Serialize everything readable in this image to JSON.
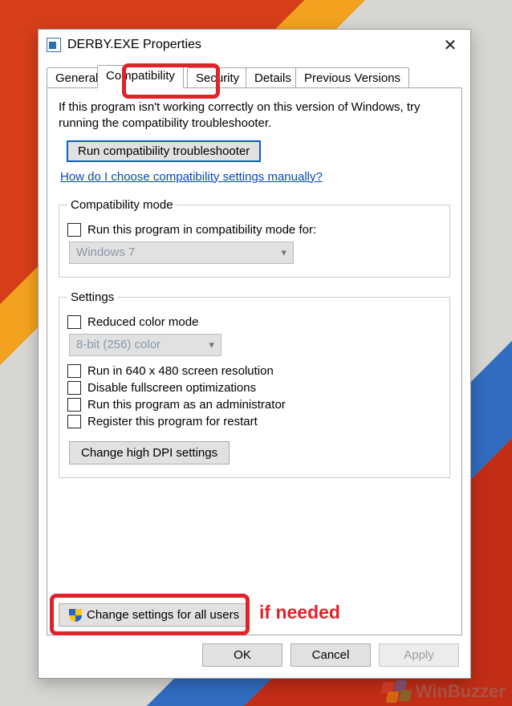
{
  "window": {
    "title": "DERBY.EXE Properties",
    "tabs": {
      "general": "General",
      "compatibility": "Compatibility",
      "security": "Security",
      "details": "Details",
      "previous": "Previous Versions"
    }
  },
  "intro": "If this program isn't working correctly on this version of Windows, try running the compatibility troubleshooter.",
  "troubleshoot_btn": "Run compatibility troubleshooter",
  "help_link": "How do I choose compatibility settings manually?",
  "compat_mode": {
    "legend": "Compatibility mode",
    "check_label": "Run this program in compatibility mode for:",
    "os_value": "Windows 7"
  },
  "settings": {
    "legend": "Settings",
    "reduced_color": "Reduced color mode",
    "color_value": "8-bit (256) color",
    "resolution": "Run in 640 x 480 screen resolution",
    "disable_fullscreen": "Disable fullscreen optimizations",
    "run_as_admin": "Run this program as an administrator",
    "register_restart": "Register this program for restart",
    "dpi_btn": "Change high DPI settings"
  },
  "all_users_btn": "Change settings for all users",
  "footer": {
    "ok": "OK",
    "cancel": "Cancel",
    "apply": "Apply"
  },
  "annotations": {
    "if_needed": "if needed"
  },
  "watermark": "WinBuzzer"
}
